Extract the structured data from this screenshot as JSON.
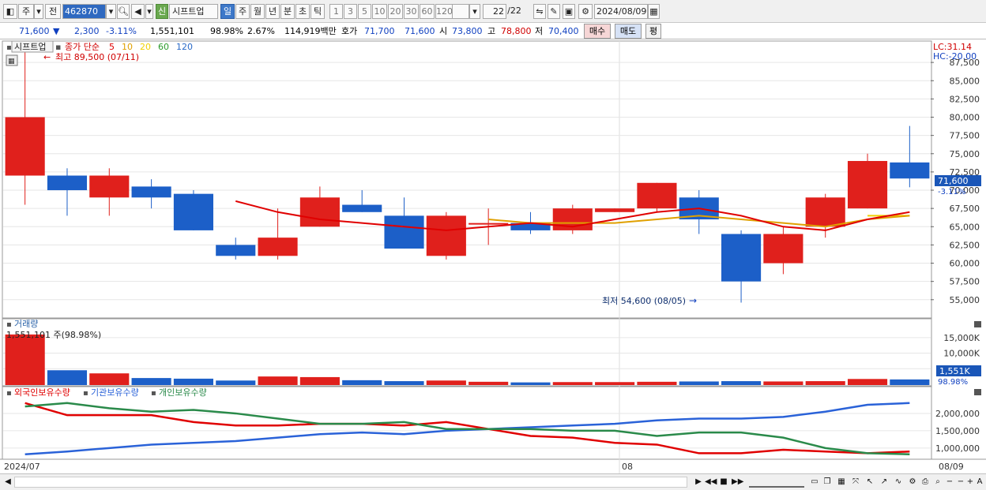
{
  "toolbar": {
    "period_mode": "주",
    "prev_label": "전",
    "stock_code": "462870",
    "new_badge": "신",
    "stock_name": "시프트업",
    "period_tabs": [
      "일",
      "주",
      "월",
      "년",
      "분",
      "초",
      "틱"
    ],
    "active_period": "일",
    "intervals": [
      "1",
      "3",
      "5",
      "10",
      "20",
      "30",
      "60",
      "120"
    ],
    "count_value": "22",
    "count_total": "/22",
    "date_value": "2024/08/09"
  },
  "quote": {
    "price": "71,600",
    "change": "2,300",
    "change_rate": "-3.11%",
    "volume": "1,551,101",
    "volume_ratio": "98.98%",
    "turnover": "2.67%",
    "amount": "114,919백만",
    "hoga_label": "호가",
    "ask": "71,700",
    "bid": "71,600",
    "open_label": "시",
    "open": "73,800",
    "high_label": "고",
    "high": "78,800",
    "low_label": "저",
    "low": "70,400",
    "buy_label": "매수",
    "sell_label": "매도",
    "extra_label": "평"
  },
  "price_panel": {
    "stock_tag": "시프트업",
    "ma_prefix": "종가 단순",
    "ma_periods": [
      "5",
      "10",
      "20",
      "60",
      "120"
    ],
    "ma_colors": [
      "#e00000",
      "#e0a000",
      "#f0d000",
      "#2a9a2a",
      "#2a6ac8"
    ],
    "lc_label": "LC:31.14",
    "hc_label": "HC:-20.00",
    "high_marker": "최고 89,500 (07/11)",
    "low_marker": "최저 54,600 (08/05)",
    "current_price": "71,600",
    "current_change": "-3.11%"
  },
  "volume_panel": {
    "title": "거래량",
    "current_text": "1,551,101 주(98.98%)",
    "current_tag": "1,551K",
    "current_ratio": "98.98%"
  },
  "holding_panel": {
    "legends": [
      "외국인보유수량",
      "기관보유수량",
      "개인보유수량"
    ],
    "colors": [
      "#e00000",
      "#2a62d8",
      "#2a8a4a"
    ]
  },
  "x_axis": {
    "labels": [
      "2024/07",
      "08",
      "08/09"
    ]
  },
  "chart_data": [
    {
      "type": "candlestick",
      "title": "시프트업",
      "ylim": [
        52600,
        90000
      ],
      "y_ticks": [
        55000,
        57500,
        60000,
        62500,
        65000,
        67500,
        70000,
        72500,
        75000,
        77500,
        80000,
        82500,
        85000,
        87500
      ],
      "candles": [
        {
          "open": 72000,
          "high": 89500,
          "low": 68000,
          "close": 80000
        },
        {
          "open": 72000,
          "high": 73000,
          "low": 66500,
          "close": 70000
        },
        {
          "open": 69000,
          "high": 73000,
          "low": 66500,
          "close": 72000
        },
        {
          "open": 70500,
          "high": 71500,
          "low": 67500,
          "close": 69000
        },
        {
          "open": 69500,
          "high": 70000,
          "low": 64500,
          "close": 64500
        },
        {
          "open": 62500,
          "high": 63500,
          "low": 60500,
          "close": 61000
        },
        {
          "open": 61000,
          "high": 67500,
          "low": 60500,
          "close": 63500
        },
        {
          "open": 65000,
          "high": 70500,
          "low": 65000,
          "close": 69000
        },
        {
          "open": 68000,
          "high": 70000,
          "low": 67000,
          "close": 67000
        },
        {
          "open": 66500,
          "high": 69000,
          "low": 62000,
          "close": 62000
        },
        {
          "open": 61000,
          "high": 67000,
          "low": 60500,
          "close": 66500
        },
        {
          "open": 65500,
          "high": 67500,
          "low": 62500,
          "close": 65500
        },
        {
          "open": 65500,
          "high": 67000,
          "low": 64000,
          "close": 64500
        },
        {
          "open": 64500,
          "high": 68000,
          "low": 64000,
          "close": 67500
        },
        {
          "open": 67000,
          "high": 67500,
          "low": 67000,
          "close": 67500
        },
        {
          "open": 67500,
          "high": 71000,
          "low": 67000,
          "close": 71000
        },
        {
          "open": 69000,
          "high": 70000,
          "low": 64000,
          "close": 66000
        },
        {
          "open": 64000,
          "high": 64500,
          "low": 54600,
          "close": 57500
        },
        {
          "open": 60000,
          "high": 65000,
          "low": 58500,
          "close": 64000
        },
        {
          "open": 65000,
          "high": 69500,
          "low": 63500,
          "close": 69000
        },
        {
          "open": 67500,
          "high": 75000,
          "low": 67500,
          "close": 74000
        },
        {
          "open": 73800,
          "high": 78800,
          "low": 70400,
          "close": 71600
        }
      ],
      "ma5": [
        null,
        null,
        null,
        null,
        null,
        68500,
        67000,
        66000,
        65500,
        65000,
        64500,
        65000,
        65500,
        65000,
        66000,
        67000,
        67500,
        66500,
        65000,
        64500,
        66000,
        67000
      ],
      "ma10": [
        null,
        null,
        null,
        null,
        null,
        null,
        null,
        null,
        null,
        null,
        null,
        66000,
        65500,
        65500,
        65500,
        66000,
        66500,
        66000,
        65500,
        65000,
        66000,
        66500
      ],
      "ma20": [
        null,
        null,
        null,
        null,
        null,
        null,
        null,
        null,
        null,
        null,
        null,
        null,
        null,
        null,
        null,
        null,
        null,
        null,
        null,
        null,
        66500,
        66500
      ]
    },
    {
      "type": "bar",
      "title": "거래량",
      "ylim": [
        0,
        18000000
      ],
      "y_ticks": [
        5000000,
        10000000,
        15000000
      ],
      "y_tick_labels": [
        "5,000K",
        "10,000K",
        "15,000K"
      ],
      "values": [
        16000000,
        4500000,
        3500000,
        2000000,
        1800000,
        1200000,
        2500000,
        2300000,
        1300000,
        1000000,
        1200000,
        800000,
        600000,
        700000,
        700000,
        800000,
        900000,
        1000000,
        900000,
        1000000,
        1700000,
        1551101
      ]
    },
    {
      "type": "line",
      "ylim": [
        700000,
        2500000
      ],
      "y_ticks": [
        1000000,
        1500000,
        2000000
      ],
      "y_tick_labels": [
        "1,000,000",
        "1,500,000",
        "2,000,000"
      ],
      "series": [
        {
          "name": "외국인보유수량",
          "values": [
            2300000,
            1950000,
            1950000,
            1950000,
            1750000,
            1650000,
            1650000,
            1700000,
            1700000,
            1650000,
            1750000,
            1550000,
            1350000,
            1300000,
            1150000,
            1100000,
            850000,
            850000,
            950000,
            900000,
            850000,
            900000
          ]
        },
        {
          "name": "기관보유수량",
          "values": [
            820000,
            900000,
            1000000,
            1100000,
            1150000,
            1200000,
            1300000,
            1400000,
            1450000,
            1400000,
            1500000,
            1550000,
            1600000,
            1650000,
            1700000,
            1800000,
            1850000,
            1850000,
            1900000,
            2050000,
            2250000,
            2300000
          ]
        },
        {
          "name": "개인보유수량",
          "values": [
            2200000,
            2300000,
            2150000,
            2050000,
            2100000,
            2000000,
            1850000,
            1700000,
            1700000,
            1750000,
            1550000,
            1550000,
            1550000,
            1500000,
            1500000,
            1350000,
            1450000,
            1450000,
            1300000,
            1000000,
            850000,
            820000
          ]
        }
      ]
    }
  ]
}
